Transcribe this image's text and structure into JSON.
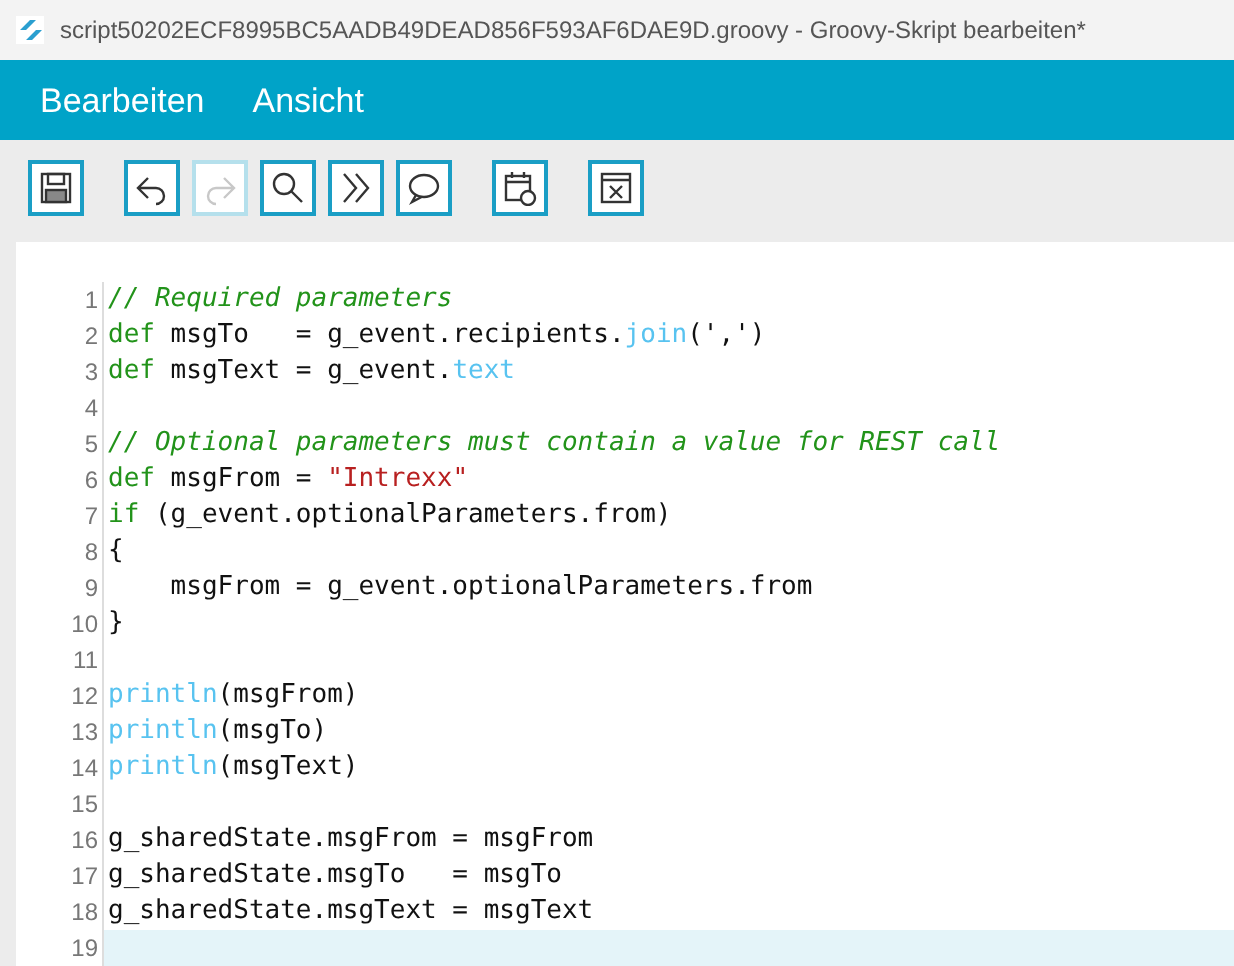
{
  "window": {
    "title": "script50202ECF8995BC5AADB49DEAD856F593AF6DAE9D.groovy - Groovy-Skript bearbeiten*"
  },
  "menu": [
    "Bearbeiten",
    "Ansicht"
  ],
  "toolbar": [
    [
      {
        "kind": "save",
        "disabled": false
      }
    ],
    [
      {
        "kind": "undo",
        "disabled": false
      },
      {
        "kind": "redo",
        "disabled": true
      },
      {
        "kind": "search",
        "disabled": false
      },
      {
        "kind": "goto",
        "disabled": false
      },
      {
        "kind": "comment",
        "disabled": false
      }
    ],
    [
      {
        "kind": "calendar",
        "disabled": false
      }
    ],
    [
      {
        "kind": "fullscreen",
        "disabled": false
      }
    ]
  ],
  "editor": {
    "lines": [
      {
        "number": "1",
        "current": false,
        "tokens": [
          {
            "kind": "comment",
            "text": "// Required parameters"
          }
        ]
      },
      {
        "number": "2",
        "current": false,
        "tokens": [
          {
            "kind": "keyword",
            "text": "def"
          },
          {
            "kind": "plain",
            "text": " msgTo   = g_event.recipients."
          },
          {
            "kind": "builtin",
            "text": "join"
          },
          {
            "kind": "plain",
            "text": "(','"
          },
          {
            "kind": "plain",
            "text": ")"
          }
        ]
      },
      {
        "number": "3",
        "current": false,
        "tokens": [
          {
            "kind": "keyword",
            "text": "def"
          },
          {
            "kind": "plain",
            "text": " msgText = g_event."
          },
          {
            "kind": "builtin",
            "text": "text"
          }
        ]
      },
      {
        "number": "4",
        "current": false
      },
      {
        "number": "5",
        "current": false,
        "tokens": [
          {
            "kind": "comment",
            "text": "// Optional parameters must contain a value for REST call"
          }
        ]
      },
      {
        "number": "6",
        "current": false,
        "tokens": [
          {
            "kind": "keyword",
            "text": "def"
          },
          {
            "kind": "plain",
            "text": " msgFrom = "
          },
          {
            "kind": "string",
            "text": "\"Intrexx\""
          }
        ]
      },
      {
        "number": "7",
        "current": false,
        "tokens": [
          {
            "kind": "keyword",
            "text": "if"
          },
          {
            "kind": "plain",
            "text": " (g_event.optionalParameters.from)"
          }
        ]
      },
      {
        "number": "8",
        "current": false,
        "tokens": [
          {
            "kind": "plain",
            "text": "{"
          }
        ]
      },
      {
        "number": "9",
        "current": false,
        "tokens": [
          {
            "kind": "plain",
            "text": "    msgFrom = g_event.optionalParameters.from"
          }
        ]
      },
      {
        "number": "10",
        "current": false,
        "tokens": [
          {
            "kind": "plain",
            "text": "}"
          }
        ]
      },
      {
        "number": "11",
        "current": false
      },
      {
        "number": "12",
        "current": false,
        "tokens": [
          {
            "kind": "builtin",
            "text": "println"
          },
          {
            "kind": "plain",
            "text": "(msgFrom)"
          }
        ]
      },
      {
        "number": "13",
        "current": false,
        "tokens": [
          {
            "kind": "builtin",
            "text": "println"
          },
          {
            "kind": "plain",
            "text": "(msgTo)"
          }
        ]
      },
      {
        "number": "14",
        "current": false,
        "tokens": [
          {
            "kind": "builtin",
            "text": "println"
          },
          {
            "kind": "plain",
            "text": "(msgText)"
          }
        ]
      },
      {
        "number": "15",
        "current": false
      },
      {
        "number": "16",
        "current": false,
        "tokens": [
          {
            "kind": "plain",
            "text": "g_sharedState.msgFrom = msgFrom"
          }
        ]
      },
      {
        "number": "17",
        "current": false,
        "tokens": [
          {
            "kind": "plain",
            "text": "g_sharedState.msgTo   = msgTo"
          }
        ]
      },
      {
        "number": "18",
        "current": false,
        "tokens": [
          {
            "kind": "plain",
            "text": "g_sharedState.msgText = msgText"
          }
        ]
      },
      {
        "number": "19",
        "current": true
      }
    ]
  }
}
